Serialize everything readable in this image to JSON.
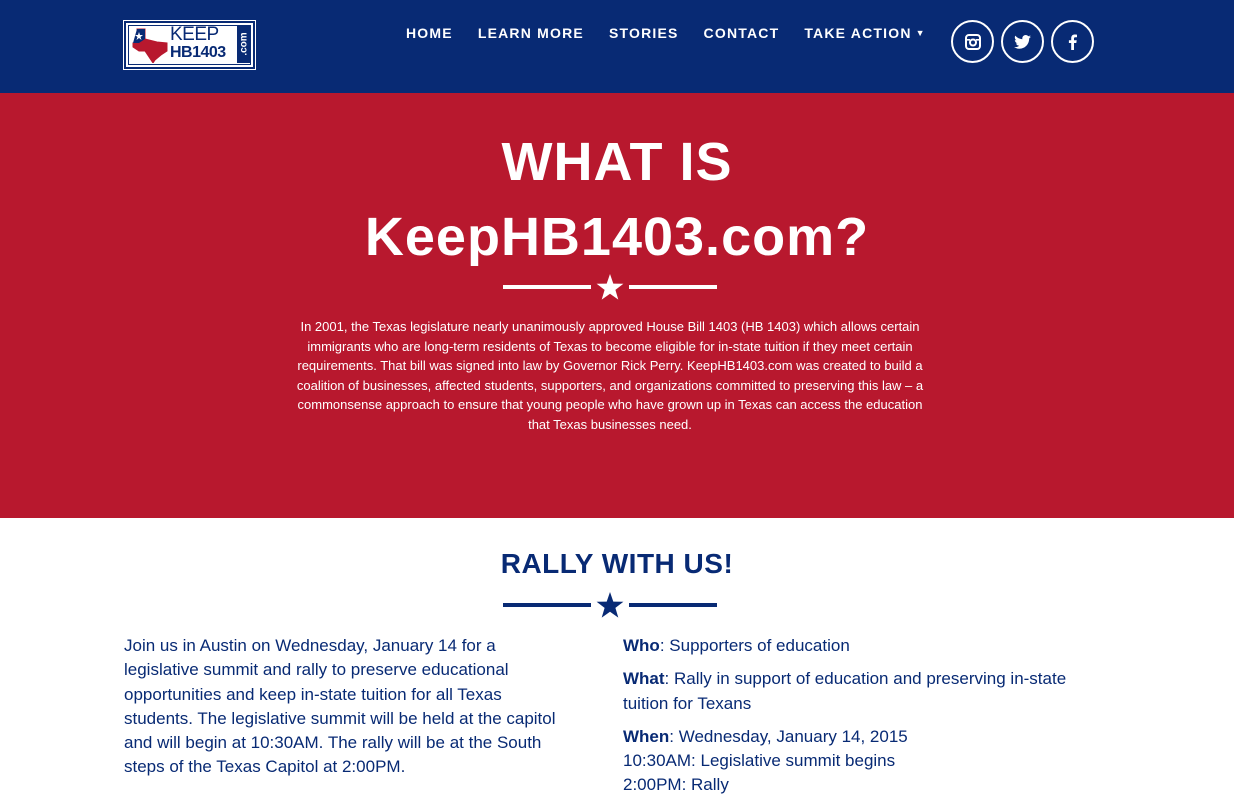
{
  "logo": {
    "line1": "KEEP",
    "line2": "HB1403",
    "suffix": ".com"
  },
  "nav": {
    "items": [
      {
        "label": "HOME"
      },
      {
        "label": "LEARN MORE"
      },
      {
        "label": "STORIES"
      },
      {
        "label": "CONTACT"
      },
      {
        "label": "TAKE ACTION"
      }
    ],
    "social": [
      {
        "icon": "instagram-icon"
      },
      {
        "icon": "twitter-icon"
      },
      {
        "icon": "facebook-icon"
      }
    ]
  },
  "hero": {
    "title_line1": "WHAT IS",
    "title_line2": "KeepHB1403.com?",
    "body": "In 2001, the Texas legislature nearly unanimously approved House Bill 1403 (HB 1403) which allows certain immigrants who are long-term residents of Texas to become eligible for in-state tuition if they meet certain requirements. That bill was signed into law by Governor Rick Perry. KeepHB1403.com was created to build a coalition of businesses, affected students, supporters, and organizations committed to preserving this law – a commonsense approach to ensure that young people who have grown up in Texas can access the education that Texas businesses need."
  },
  "rally": {
    "title": "RALLY WITH US!",
    "intro": "Join us in Austin on Wednesday, January 14 for a legislative summit and rally to preserve educational opportunities and keep in-state tuition for all Texas students. The legislative summit will be held at the capitol and will begin at 10:30AM. The rally will be at the South steps of the Texas Capitol at 2:00PM.",
    "who_label": "Who",
    "who_value": ": Supporters of education",
    "what_label": "What",
    "what_value": ": Rally in support of education and preserving in-state tuition for Texans",
    "when_label": "When",
    "when_value": ": Wednesday, January 14, 2015",
    "when_line2": "10:30AM: Legislative summit begins",
    "when_line3": "2:00PM: Rally"
  },
  "colors": {
    "navy": "#082a74",
    "red": "#b8182e",
    "white": "#ffffff"
  }
}
